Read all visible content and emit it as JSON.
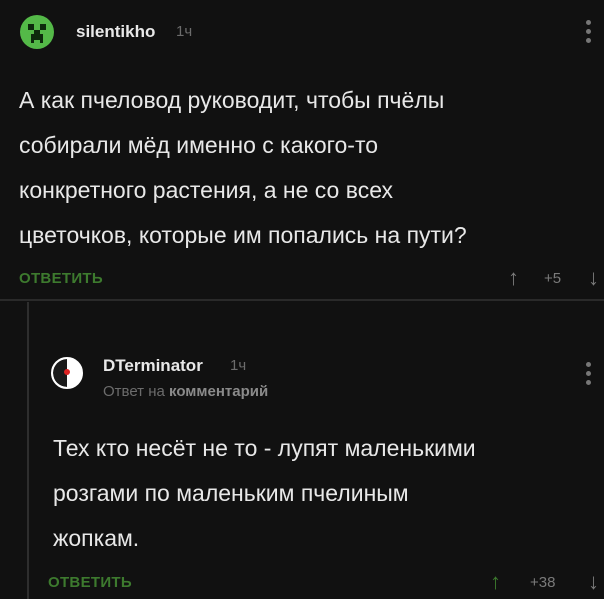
{
  "comments": [
    {
      "username": "silentikho",
      "time": "1ч",
      "avatar_icon": "creeper-avatar-icon",
      "lines": [
        "А как пчеловод руководит, чтобы пчёлы",
        "собирали мёд именно с какого-то",
        "конкретного растения, а не со всех",
        "цветочков, которые им попались на пути?"
      ],
      "reply_label": "ОТВЕТИТЬ",
      "rating": "+5"
    },
    {
      "username": "DTerminator",
      "time": "1ч",
      "avatar_icon": "terminator-avatar-icon",
      "reply_to_prefix": "Ответ на",
      "reply_to_link": "комментарий",
      "lines": [
        "Тех кто несёт не то - лупят маленькими",
        "розгами по маленьким пчелиным",
        "жопкам."
      ],
      "reply_label": "ОТВЕТИТЬ",
      "rating": "+38"
    }
  ],
  "icons": {
    "upvote": "↑",
    "downvote": "↓",
    "more": "more-vertical-icon"
  },
  "colors": {
    "background": "#111111",
    "accent": "#3d7a2e",
    "muted": "#6c6c6c",
    "text": "#e8e8e8"
  }
}
